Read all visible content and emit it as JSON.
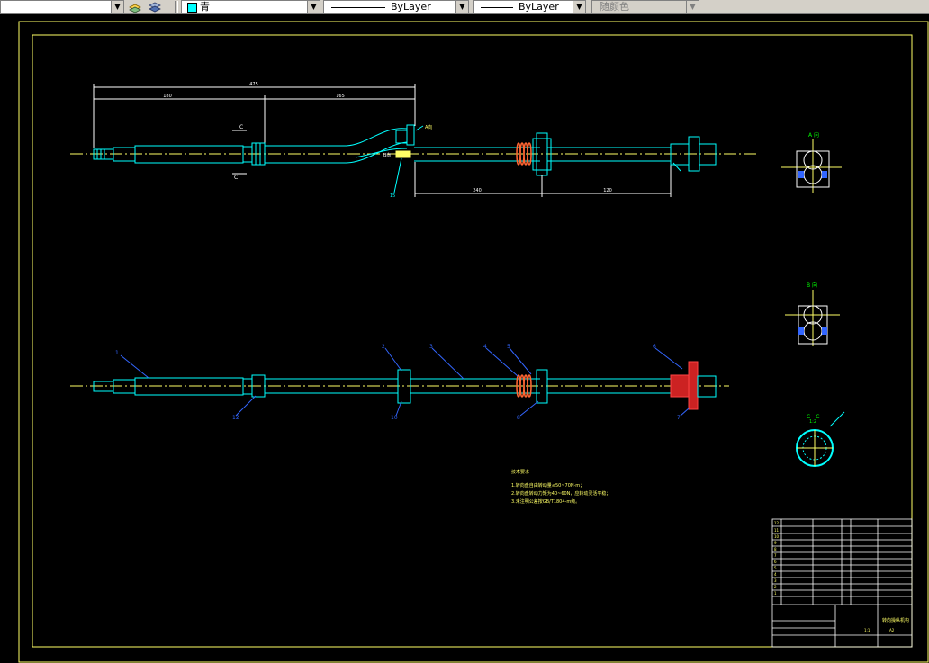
{
  "toolbar": {
    "color_value": "青",
    "linetype_value": "ByLayer",
    "lineweight_value": "ByLayer",
    "plotstyle_value": "随颜色"
  },
  "drawing": {
    "views": {
      "view_a": "A 向",
      "view_b": "B 向",
      "section_c": "C—C",
      "section_scale": "1:2",
      "section_mark_c": "C"
    },
    "tech_requirements": {
      "title": "技术要求",
      "items": [
        "1.转向盘自由转动量≤50~70N·m；",
        "2.转向盘转动力矩为40~60N，应转动灵活平稳；",
        "3.未注明公差按GB/T1804-m级。"
      ]
    },
    "title_block": {
      "drawing_title": "转向操纵机构",
      "scale": "1:1",
      "material": "A2"
    }
  }
}
